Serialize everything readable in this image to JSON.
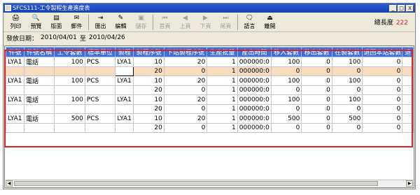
{
  "window": {
    "title": "SFCS111-工令製程生產進度表",
    "controls": [
      "_",
      "□",
      "X"
    ]
  },
  "toolbar": {
    "buttons": [
      {
        "label": "列印",
        "icon": "printer-icon",
        "glyph": "🖨",
        "enabled": true
      },
      {
        "label": "預覽",
        "icon": "preview-icon",
        "glyph": "🔍",
        "enabled": true
      },
      {
        "label": "版面",
        "icon": "layout-icon",
        "glyph": "▤",
        "enabled": true
      },
      {
        "label": "郵件",
        "icon": "mail-icon",
        "glyph": "✉",
        "enabled": true
      },
      {
        "label": "匯出",
        "icon": "export-icon",
        "glyph": "⇥",
        "enabled": true
      },
      {
        "label": "編輯",
        "icon": "edit-icon",
        "glyph": "✎",
        "enabled": true
      },
      {
        "label": "儲存",
        "icon": "save-icon",
        "glyph": "▣",
        "enabled": false
      },
      {
        "label": "首頁",
        "icon": "first-page-icon",
        "glyph": "⏮",
        "enabled": false
      },
      {
        "label": "上頁",
        "icon": "prev-page-icon",
        "glyph": "◀",
        "enabled": false
      },
      {
        "label": "下頁",
        "icon": "next-page-icon",
        "glyph": "▶",
        "enabled": false
      },
      {
        "label": "尾頁",
        "icon": "last-page-icon",
        "glyph": "⏭",
        "enabled": false
      },
      {
        "label": "語言",
        "icon": "language-icon",
        "glyph": "🗨",
        "enabled": true
      },
      {
        "label": "離開",
        "icon": "exit-icon",
        "glyph": "⏏",
        "enabled": true
      }
    ],
    "total_label": "總長度",
    "total_value": "222"
  },
  "filter": {
    "label": "發放日期：",
    "start": "2010/04/01",
    "to": "至",
    "end": "2010/04/26"
  },
  "table": {
    "columns": [
      "件號",
      "件號名稱",
      "工令套數",
      "標準單位",
      "製程",
      "製程序號",
      "下站製程序號",
      "生產批量",
      "產出時間",
      "移入套數",
      "移出套數",
      "在製套數",
      "退回本站套數",
      "退"
    ],
    "rows": [
      [
        "LYA1",
        "電話",
        "100",
        "PCS",
        "LYA1",
        "10",
        "20",
        "1",
        "000000:0",
        "100",
        "0",
        "100",
        "0",
        ""
      ],
      [
        "",
        "",
        "",
        "",
        "",
        "20",
        "0",
        "1",
        "000000:0",
        "0",
        "0",
        "0",
        "0",
        ""
      ],
      [
        "LYA1",
        "電話",
        "100",
        "PCS",
        "LYA1",
        "10",
        "20",
        "1",
        "000000:0",
        "100",
        "0",
        "100",
        "0",
        ""
      ],
      [
        "",
        "",
        "",
        "",
        "",
        "20",
        "0",
        "1",
        "000000:0",
        "0",
        "0",
        "0",
        "0",
        ""
      ],
      [
        "LYA1",
        "電話",
        "100",
        "PCS",
        "LYA1",
        "10",
        "20",
        "1",
        "000000:0",
        "100",
        "0",
        "100",
        "0",
        ""
      ],
      [
        "",
        "",
        "",
        "",
        "",
        "20",
        "0",
        "1",
        "000000:0",
        "0",
        "0",
        "0",
        "0",
        ""
      ],
      [
        "LYA1",
        "電話",
        "500",
        "PCS",
        "LYA1",
        "10",
        "20",
        "1",
        "000000:0",
        "500",
        "0",
        "500",
        "0",
        ""
      ],
      [
        "",
        "",
        "",
        "",
        "",
        "20",
        "0",
        "1",
        "000000:0",
        "0",
        "0",
        "0",
        "0",
        ""
      ]
    ],
    "selected_row": 1,
    "focus_col": 4
  },
  "colors": {
    "header_bg": "#3d6fd6",
    "selected_row_bg": "#f8dcc0",
    "highlight_frame": "#e02020",
    "total_value": "#d42020"
  }
}
